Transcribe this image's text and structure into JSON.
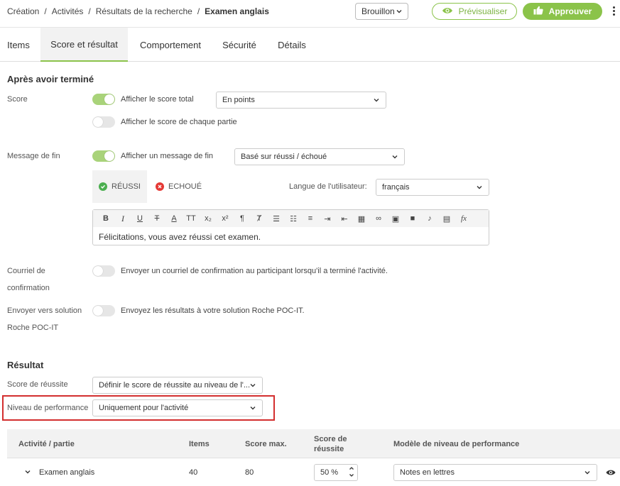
{
  "breadcrumb": {
    "items": [
      "Création",
      "Activités",
      "Résultats de la recherche"
    ],
    "current": "Examen anglais",
    "separator": "/"
  },
  "header": {
    "status_select": "Brouillon",
    "preview_label": "Prévisualiser",
    "approve_label": "Approuver",
    "accent_color": "#8bc34a"
  },
  "tabs": [
    {
      "label": "Items"
    },
    {
      "label": "Score et résultat"
    },
    {
      "label": "Comportement"
    },
    {
      "label": "Sécurité"
    },
    {
      "label": "Détails"
    }
  ],
  "after": {
    "title": "Après avoir terminé",
    "score_label": "Score",
    "show_total_label": "Afficher le score total",
    "score_unit_select": "En points",
    "show_parts_label": "Afficher le score de chaque partie",
    "end_message_label": "Message de fin",
    "show_end_message_label": "Afficher un message de fin",
    "end_message_mode": "Basé sur réussi / échoué",
    "tab_pass": "RÉUSSI",
    "tab_fail": "ECHOUÉ",
    "user_lang_label": "Langue de l'utilisateur:",
    "user_lang_value": "français",
    "editor_text": "Félicitations, vous avez réussi cet examen.",
    "email_label_1": "Courriel de",
    "email_label_2": "confirmation",
    "email_toggle_label": "Envoyer un courriel de confirmation au participant lorsqu'il a terminé l'activité.",
    "poc_label_1": "Envoyer vers solution",
    "poc_label_2": "Roche POC-IT",
    "poc_toggle_label": "Envoyez les résultats à votre solution Roche POC-IT."
  },
  "result": {
    "title": "Résultat",
    "pass_score_label": "Score de réussite",
    "pass_score_value": "Définir le score de réussite au niveau de l'...",
    "perf_label": "Niveau de performance",
    "perf_value": "Uniquement pour l'activité"
  },
  "table": {
    "headers": {
      "activity": "Activité / partie",
      "items": "Items",
      "max": "Score max.",
      "pass_1": "Score de",
      "pass_2": "réussite",
      "model": "Modèle de niveau de performance"
    },
    "rows": [
      {
        "name": "Examen anglais",
        "items": "40",
        "max": "80",
        "pass": "50 %",
        "model": "Notes en lettres"
      }
    ]
  }
}
